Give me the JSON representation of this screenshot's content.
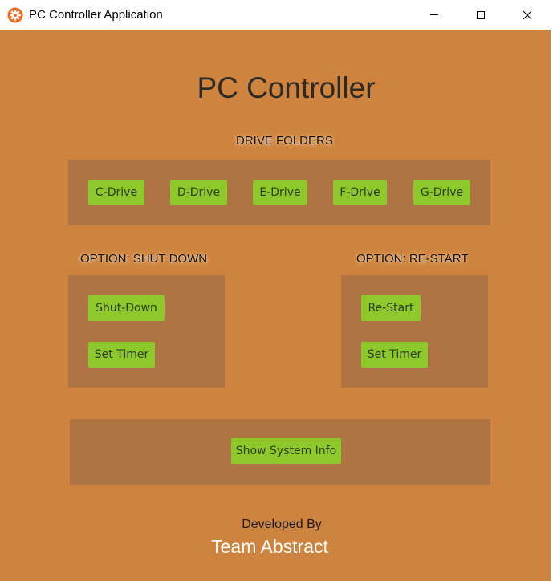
{
  "window": {
    "title": "PC Controller Application",
    "icon": "gear-icon",
    "controls": [
      "minimize-icon",
      "maximize-icon",
      "close-icon"
    ]
  },
  "colors": {
    "background": "#CE843E",
    "panel": "#AE7443",
    "button": "#8DC92B",
    "footer_team": "#FFFFFF"
  },
  "header": {
    "title": "PC Controller"
  },
  "drives": {
    "label": "DRIVE FOLDERS",
    "buttons": [
      "C-Drive",
      "D-Drive",
      "E-Drive",
      "F-Drive",
      "G-Drive"
    ]
  },
  "shutdown": {
    "label": "OPTION: SHUT DOWN",
    "action_label": "Shut-Down",
    "timer_label": "Set Timer"
  },
  "restart": {
    "label": "OPTION: RE-START",
    "action_label": "Re-Start",
    "timer_label": "Set Timer"
  },
  "system_info": {
    "button_label": "Show System Info"
  },
  "footer": {
    "developed_by": "Developed By",
    "team": "Team Abstract"
  }
}
